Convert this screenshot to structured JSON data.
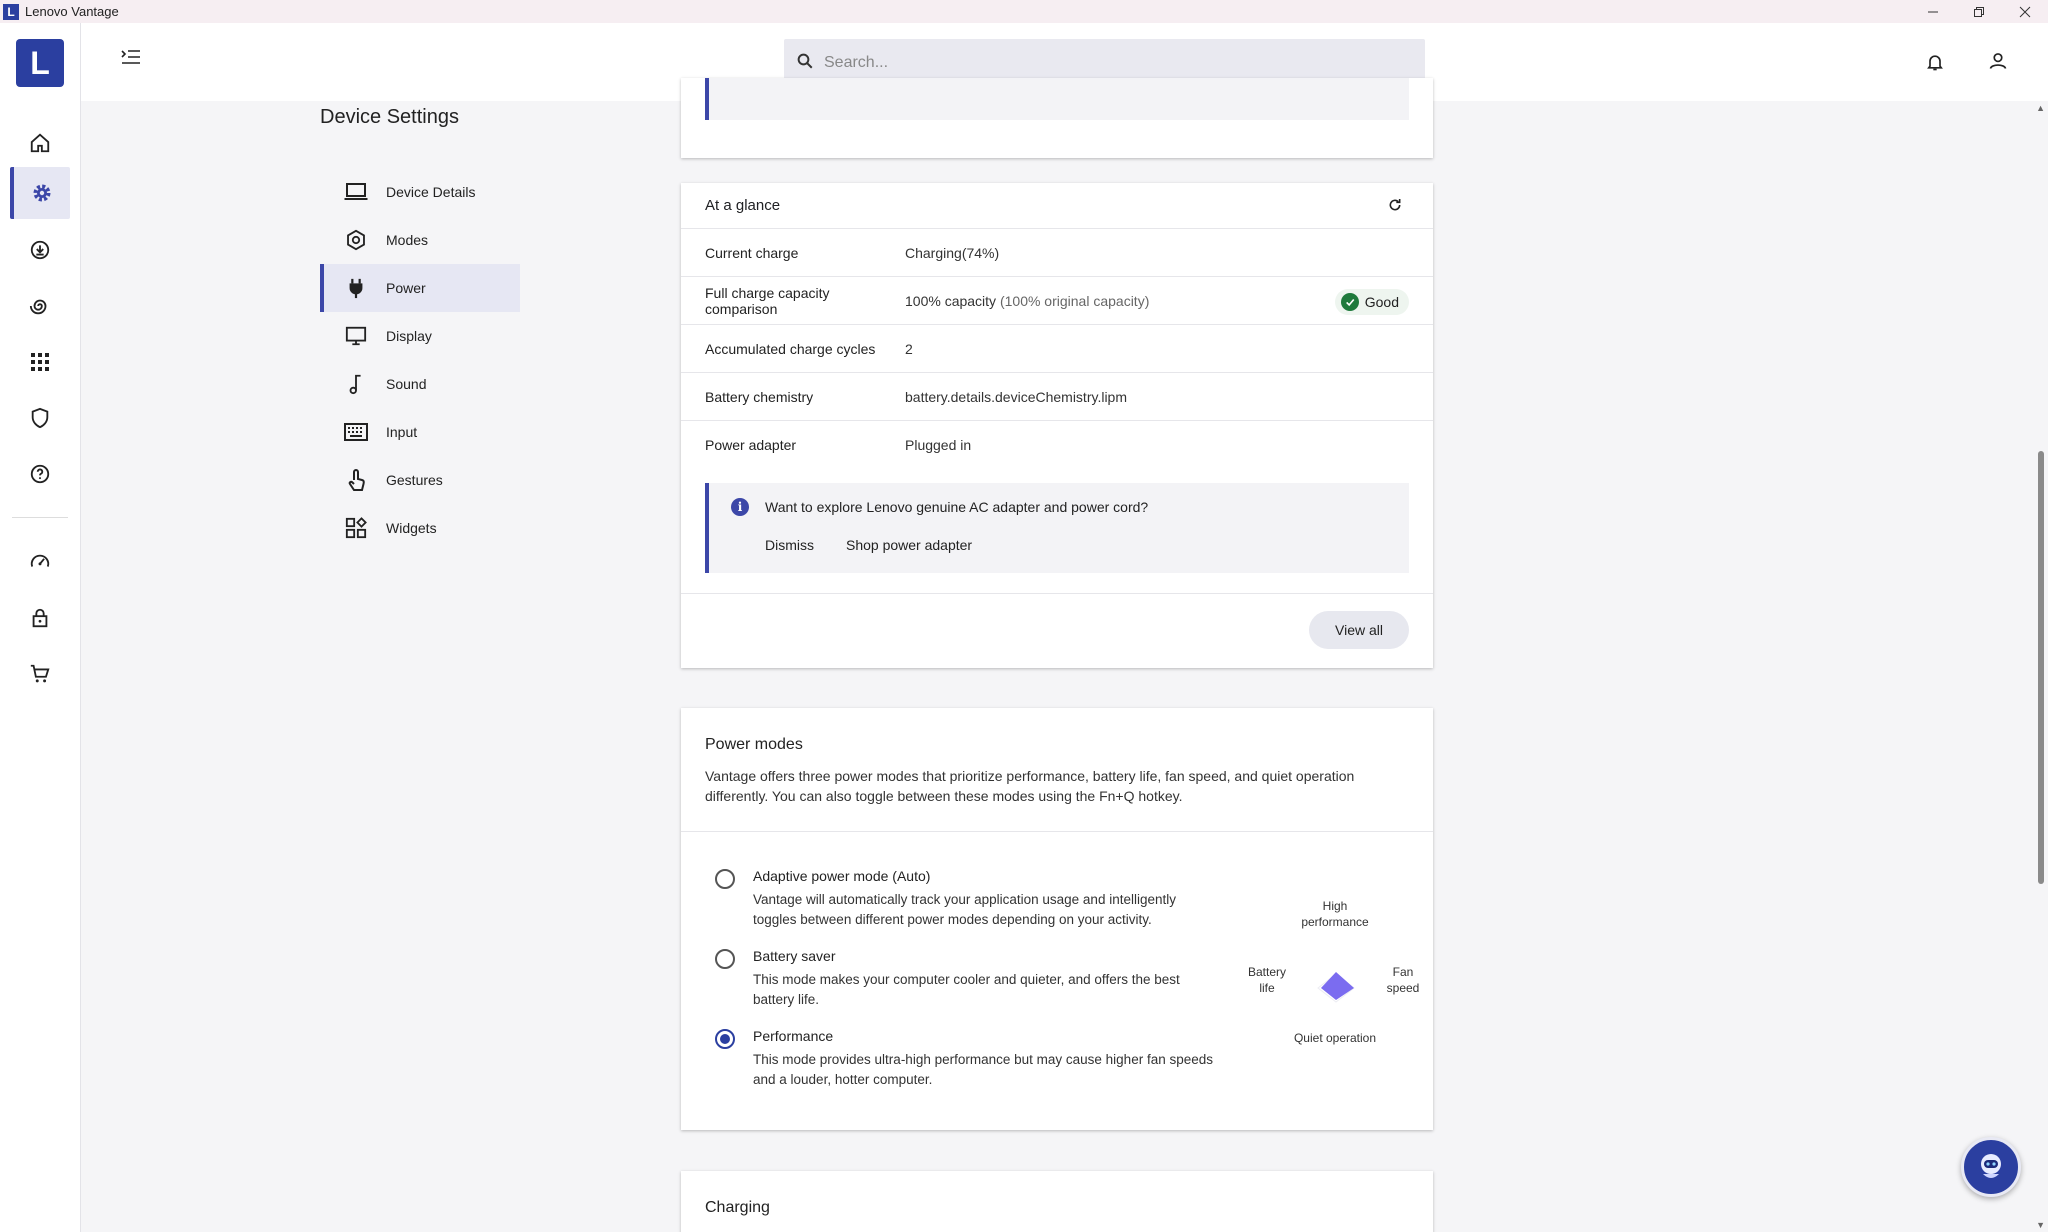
{
  "window": {
    "title": "Lenovo Vantage",
    "logo_letter": "L"
  },
  "rail": {
    "logo_letter": "L"
  },
  "search": {
    "placeholder": "Search..."
  },
  "settings": {
    "title": "Device Settings",
    "nav": [
      {
        "label": "Device Details",
        "icon": "laptop-icon"
      },
      {
        "label": "Modes",
        "icon": "modes-icon"
      },
      {
        "label": "Power",
        "icon": "plug-icon",
        "active": true
      },
      {
        "label": "Display",
        "icon": "monitor-icon"
      },
      {
        "label": "Sound",
        "icon": "music-note-icon"
      },
      {
        "label": "Input",
        "icon": "keyboard-icon"
      },
      {
        "label": "Gestures",
        "icon": "touch-icon"
      },
      {
        "label": "Widgets",
        "icon": "widgets-icon"
      }
    ]
  },
  "glance": {
    "title": "At a glance",
    "rows": [
      {
        "label": "Current charge",
        "value": "Charging(74%)"
      },
      {
        "label": "Full charge capacity comparison",
        "value": "100% capacity",
        "value_note": "(100% original capacity)",
        "badge": "Good"
      },
      {
        "label": "Accumulated charge cycles",
        "value": "2"
      },
      {
        "label": "Battery chemistry",
        "value": "battery.details.deviceChemistry.lipm"
      },
      {
        "label": "Power adapter",
        "value": "Plugged in"
      }
    ],
    "info": {
      "message": "Want to explore Lenovo genuine AC adapter and power cord?",
      "dismiss": "Dismiss",
      "shop": "Shop power adapter"
    },
    "view_all": "View all"
  },
  "power_modes": {
    "title": "Power modes",
    "description": "Vantage offers three power modes that prioritize performance, battery life, fan speed, and quiet operation differently. You can also toggle between these modes using the Fn+Q hotkey.",
    "modes": [
      {
        "title": "Adaptive power mode (Auto)",
        "description": "Vantage will automatically track your application usage and intelligently toggles between different power modes depending on your activity.",
        "selected": false
      },
      {
        "title": "Battery saver",
        "description": "This mode makes your computer cooler and quieter, and offers the best battery life.",
        "selected": false
      },
      {
        "title": "Performance",
        "description": "This mode provides ultra-high performance but may cause higher fan speeds and a louder, hotter computer.",
        "selected": true
      }
    ],
    "radar": {
      "top": "High performance",
      "left": "Battery life",
      "right": "Fan speed",
      "bottom": "Quiet operation",
      "fill_color": "#7b6cf0"
    }
  },
  "charging": {
    "title": "Charging"
  },
  "colors": {
    "accent": "#3c47a8",
    "brand": "#2b3fa0",
    "good": "#1f7a3c"
  }
}
